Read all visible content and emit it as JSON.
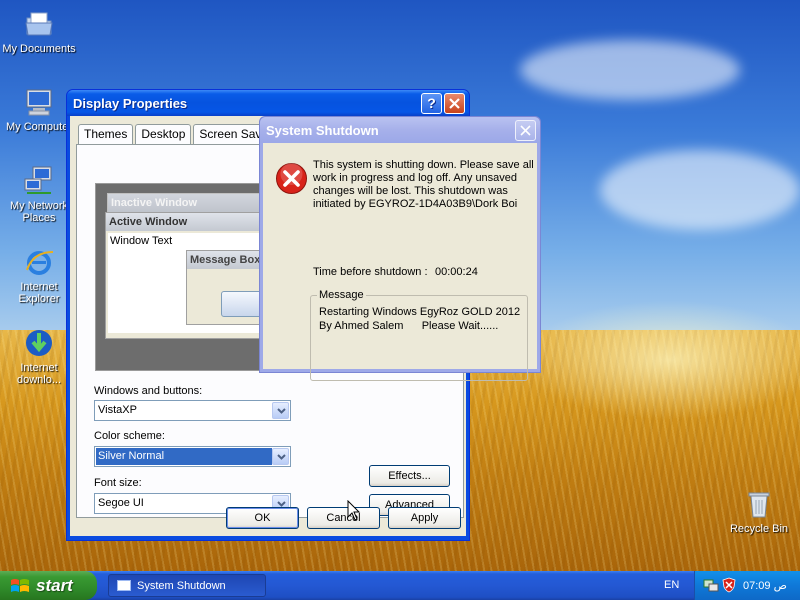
{
  "desktop": {
    "icons": [
      {
        "label": "My Documents",
        "icon": "folder-documents-icon"
      },
      {
        "label": "My Computer",
        "icon": "computer-icon"
      },
      {
        "label": "My Network Places",
        "icon": "network-icon"
      },
      {
        "label": "Internet Explorer",
        "icon": "internet-explorer-icon"
      },
      {
        "label": "Internet downlo...",
        "icon": "download-manager-icon"
      },
      {
        "label": "Recycle Bin",
        "icon": "recycle-bin-icon"
      }
    ]
  },
  "display_properties": {
    "title": "Display Properties",
    "tabs": [
      "Themes",
      "Desktop",
      "Screen Saver"
    ],
    "preview": {
      "inactive_title": "Inactive Window",
      "active_title": "Active Window",
      "window_text": "Window Text",
      "message_box_title": "Message Box"
    },
    "windows_buttons_label": "Windows and buttons:",
    "windows_buttons_value": "VistaXP",
    "color_scheme_label": "Color scheme:",
    "color_scheme_value": "Silver Normal",
    "font_size_label": "Font size:",
    "font_size_value": "Segoe UI",
    "effects_label": "Effects...",
    "advanced_label": "Advanced",
    "ok_label": "OK",
    "cancel_label": "Cancel",
    "apply_label": "Apply"
  },
  "shutdown_dialog": {
    "title": "System Shutdown",
    "message": "This system is shutting down. Please save all work in progress and log off. Any unsaved changes will be lost. This shutdown was initiated by EGYROZ-1D4A03B9\\Dork Boi",
    "time_label": "Time before shutdown :",
    "time_value": "00:00:24",
    "group_label": "Message",
    "group_message": "Restarting Windows EgyRoz GOLD 2012\nBy Ahmed Salem      Please Wait......"
  },
  "taskbar": {
    "start_label": "start",
    "task_label": "System Shutdown",
    "language": "EN",
    "clock": "07:09 ص"
  },
  "colors": {
    "xp_blue_title": "#0653df",
    "start_green": "#2f8b2a",
    "selection": "#316ac5",
    "dialog_face": "#ece9d8"
  }
}
